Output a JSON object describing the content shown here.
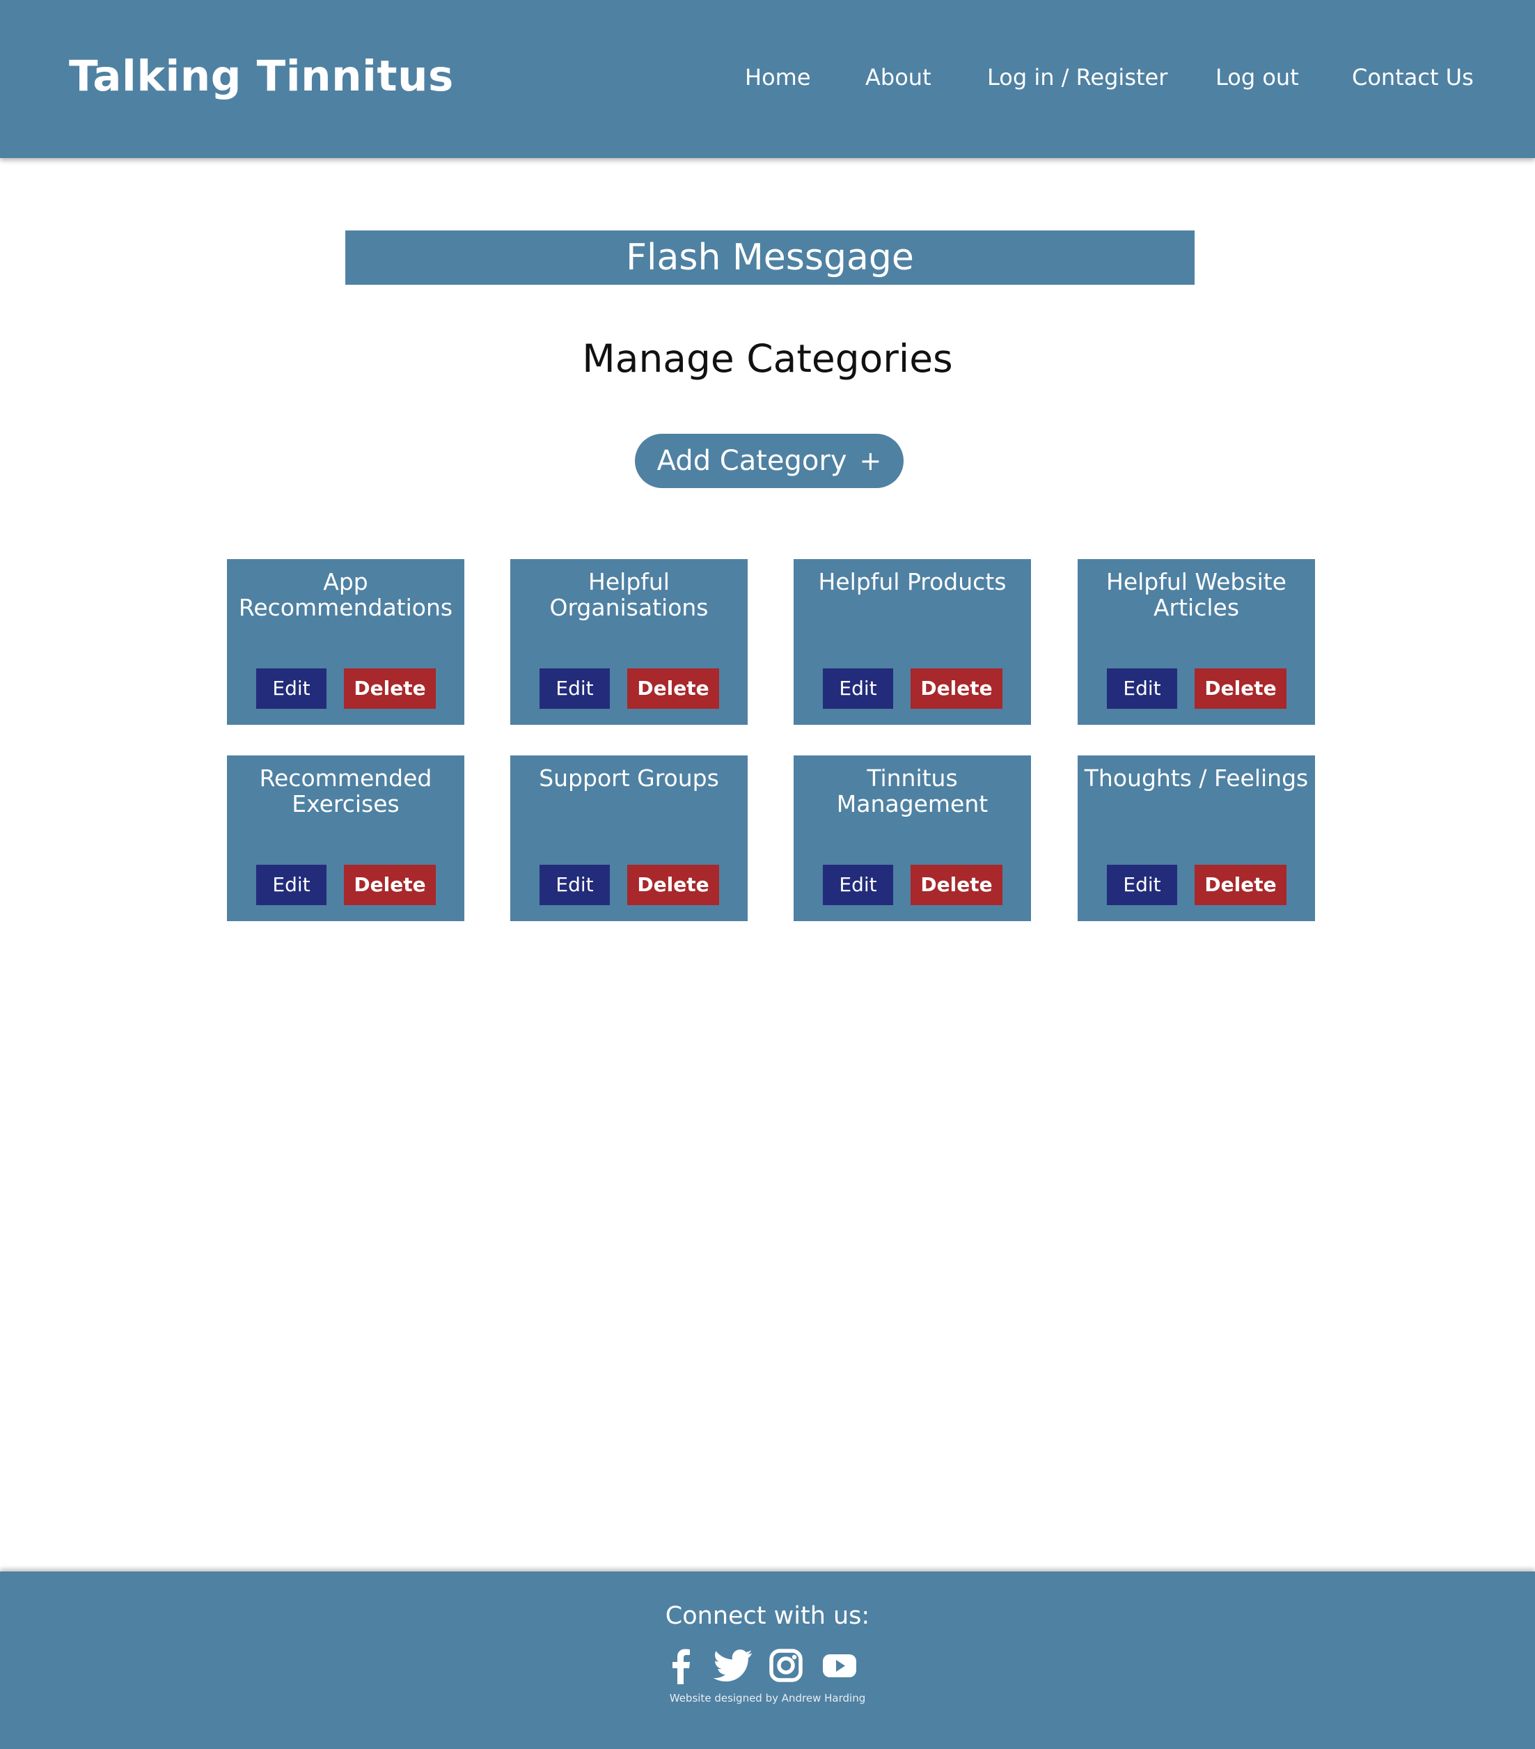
{
  "header": {
    "brand": "Talking Tinnitus",
    "nav": [
      "Home",
      "About",
      "Log in / Register",
      "Log out",
      "Contact Us"
    ]
  },
  "flash": {
    "text": "Flash Messgage"
  },
  "page": {
    "title": "Manage Categories",
    "add_button": "Add Category",
    "add_symbol": "+"
  },
  "categories": [
    {
      "title": "App Recommendations",
      "edit": "Edit",
      "delete": "Delete"
    },
    {
      "title": "Helpful Organisations",
      "edit": "Edit",
      "delete": "Delete"
    },
    {
      "title": "Helpful Products",
      "edit": "Edit",
      "delete": "Delete"
    },
    {
      "title": "Helpful Website Articles",
      "edit": "Edit",
      "delete": "Delete"
    },
    {
      "title": "Recommended Exercises",
      "edit": "Edit",
      "delete": "Delete"
    },
    {
      "title": "Support Groups",
      "edit": "Edit",
      "delete": "Delete"
    },
    {
      "title": "Tinnitus Management",
      "edit": "Edit",
      "delete": "Delete"
    },
    {
      "title": "Thoughts / Feelings",
      "edit": "Edit",
      "delete": "Delete"
    }
  ],
  "footer": {
    "connect": "Connect with us:",
    "social_icons": [
      "facebook-icon",
      "twitter-icon",
      "instagram-icon",
      "youtube-icon"
    ],
    "credit": "Website designed by Andrew Harding"
  },
  "colors": {
    "primary": "#4f81a2",
    "edit_button": "#232c7a",
    "delete_button": "#a8282b",
    "text_light": "#ffffff"
  }
}
